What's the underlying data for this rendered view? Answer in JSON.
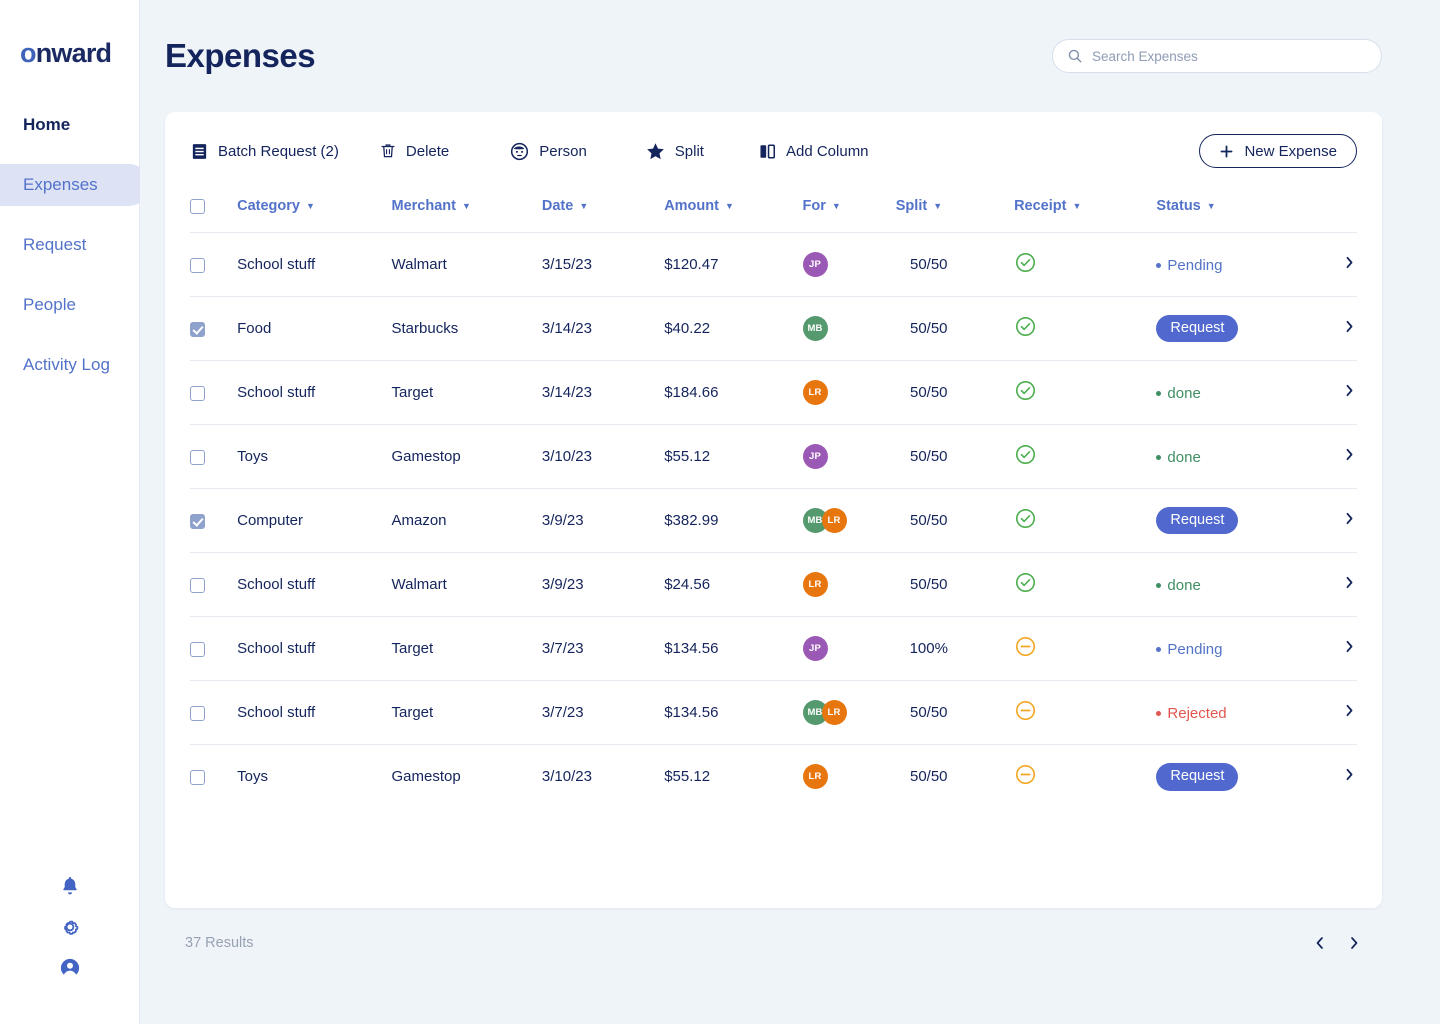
{
  "app": {
    "logo_first": "o",
    "logo_rest": "nward"
  },
  "sidebar": {
    "items": [
      {
        "label": "Home",
        "name": "home"
      },
      {
        "label": "Expenses",
        "name": "expenses"
      },
      {
        "label": "Request",
        "name": "request"
      },
      {
        "label": "People",
        "name": "people"
      },
      {
        "label": "Activity Log",
        "name": "activity-log"
      }
    ],
    "active": "Expenses",
    "bottom_icons": [
      "bell-icon",
      "gear-icon",
      "account-icon"
    ]
  },
  "header": {
    "title": "Expenses",
    "search": {
      "placeholder": "Search Expenses",
      "value": "",
      "icon": "search-icon"
    }
  },
  "toolbar": {
    "batch_request": "Batch Request (2)",
    "delete": "Delete",
    "person": "Person",
    "split": "Split",
    "add_column": "Add Column",
    "new_expense": "New Expense",
    "icons": {
      "batch": "receipt-icon",
      "delete": "trash-icon",
      "person": "person-face-icon",
      "split": "star-icon",
      "add_column": "columns-icon",
      "new_expense": "plus-icon"
    }
  },
  "table": {
    "columns": [
      {
        "label": "Category",
        "key": "category"
      },
      {
        "label": "Merchant",
        "key": "merchant"
      },
      {
        "label": "Date",
        "key": "date"
      },
      {
        "label": "Amount",
        "key": "amount"
      },
      {
        "label": "For",
        "key": "for"
      },
      {
        "label": "Split",
        "key": "split"
      },
      {
        "label": "Receipt",
        "key": "receipt"
      },
      {
        "label": "Status",
        "key": "status"
      }
    ],
    "rows": [
      {
        "selected": false,
        "category": "School stuff",
        "merchant": "Walmart",
        "date": "3/15/23",
        "amount": "$120.47",
        "for": [
          {
            "initials": "JP",
            "color": "#9b59b6"
          }
        ],
        "split": "50/50",
        "receipt": "check",
        "status_type": "text",
        "status": "Pending",
        "status_color": "#5372c9"
      },
      {
        "selected": true,
        "category": "Food",
        "merchant": "Starbucks",
        "date": "3/14/23",
        "amount": "$40.22",
        "for": [
          {
            "initials": "MB",
            "color": "#55996f"
          }
        ],
        "split": "50/50",
        "receipt": "check",
        "status_type": "pill",
        "status": "Request",
        "status_color": "#5169cf"
      },
      {
        "selected": false,
        "category": "School stuff",
        "merchant": "Target",
        "date": "3/14/23",
        "amount": "$184.66",
        "for": [
          {
            "initials": "LR",
            "color": "#e8760e"
          }
        ],
        "split": "50/50",
        "receipt": "check",
        "status_type": "text",
        "status": "done",
        "status_color": "#3f8f63"
      },
      {
        "selected": false,
        "category": "Toys",
        "merchant": "Gamestop",
        "date": "3/10/23",
        "amount": "$55.12",
        "for": [
          {
            "initials": "JP",
            "color": "#9b59b6"
          }
        ],
        "split": "50/50",
        "receipt": "check",
        "status_type": "text",
        "status": "done",
        "status_color": "#3f8f63"
      },
      {
        "selected": true,
        "category": "Computer",
        "merchant": "Amazon",
        "date": "3/9/23",
        "amount": "$382.99",
        "for": [
          {
            "initials": "MB",
            "color": "#55996f"
          },
          {
            "initials": "LR",
            "color": "#e8760e"
          }
        ],
        "split": "50/50",
        "receipt": "check",
        "status_type": "pill",
        "status": "Request",
        "status_color": "#5169cf"
      },
      {
        "selected": false,
        "category": "School stuff",
        "merchant": "Walmart",
        "date": "3/9/23",
        "amount": "$24.56",
        "for": [
          {
            "initials": "LR",
            "color": "#e8760e"
          }
        ],
        "split": "50/50",
        "receipt": "check",
        "status_type": "text",
        "status": "done",
        "status_color": "#3f8f63"
      },
      {
        "selected": false,
        "category": "School stuff",
        "merchant": "Target",
        "date": "3/7/23",
        "amount": "$134.56",
        "for": [
          {
            "initials": "JP",
            "color": "#9b59b6"
          }
        ],
        "split": "100%",
        "receipt": "minus",
        "status_type": "text",
        "status": "Pending",
        "status_color": "#5372c9"
      },
      {
        "selected": false,
        "category": "School stuff",
        "merchant": "Target",
        "date": "3/7/23",
        "amount": "$134.56",
        "for": [
          {
            "initials": "MB",
            "color": "#55996f"
          },
          {
            "initials": "LR",
            "color": "#e8760e"
          }
        ],
        "split": "50/50",
        "receipt": "minus",
        "status_type": "text",
        "status": "Rejected",
        "status_color": "#e0564e"
      },
      {
        "selected": false,
        "category": "Toys",
        "merchant": "Gamestop",
        "date": "3/10/23",
        "amount": "$55.12",
        "for": [
          {
            "initials": "LR",
            "color": "#e8760e"
          }
        ],
        "split": "50/50",
        "receipt": "minus",
        "status_type": "pill",
        "status": "Request",
        "status_color": "#5169cf"
      }
    ]
  },
  "footer": {
    "results": "37 Results",
    "prev_icon": "chevron-left-icon",
    "next_icon": "chevron-right-icon"
  },
  "colors": {
    "brand_navy": "#14245c",
    "brand_blue": "#5372c9",
    "accent_pill": "#5169cf",
    "receipt_ok": "#4caf50",
    "receipt_pending": "#f5a623",
    "page_bg": "#eff4f9"
  }
}
